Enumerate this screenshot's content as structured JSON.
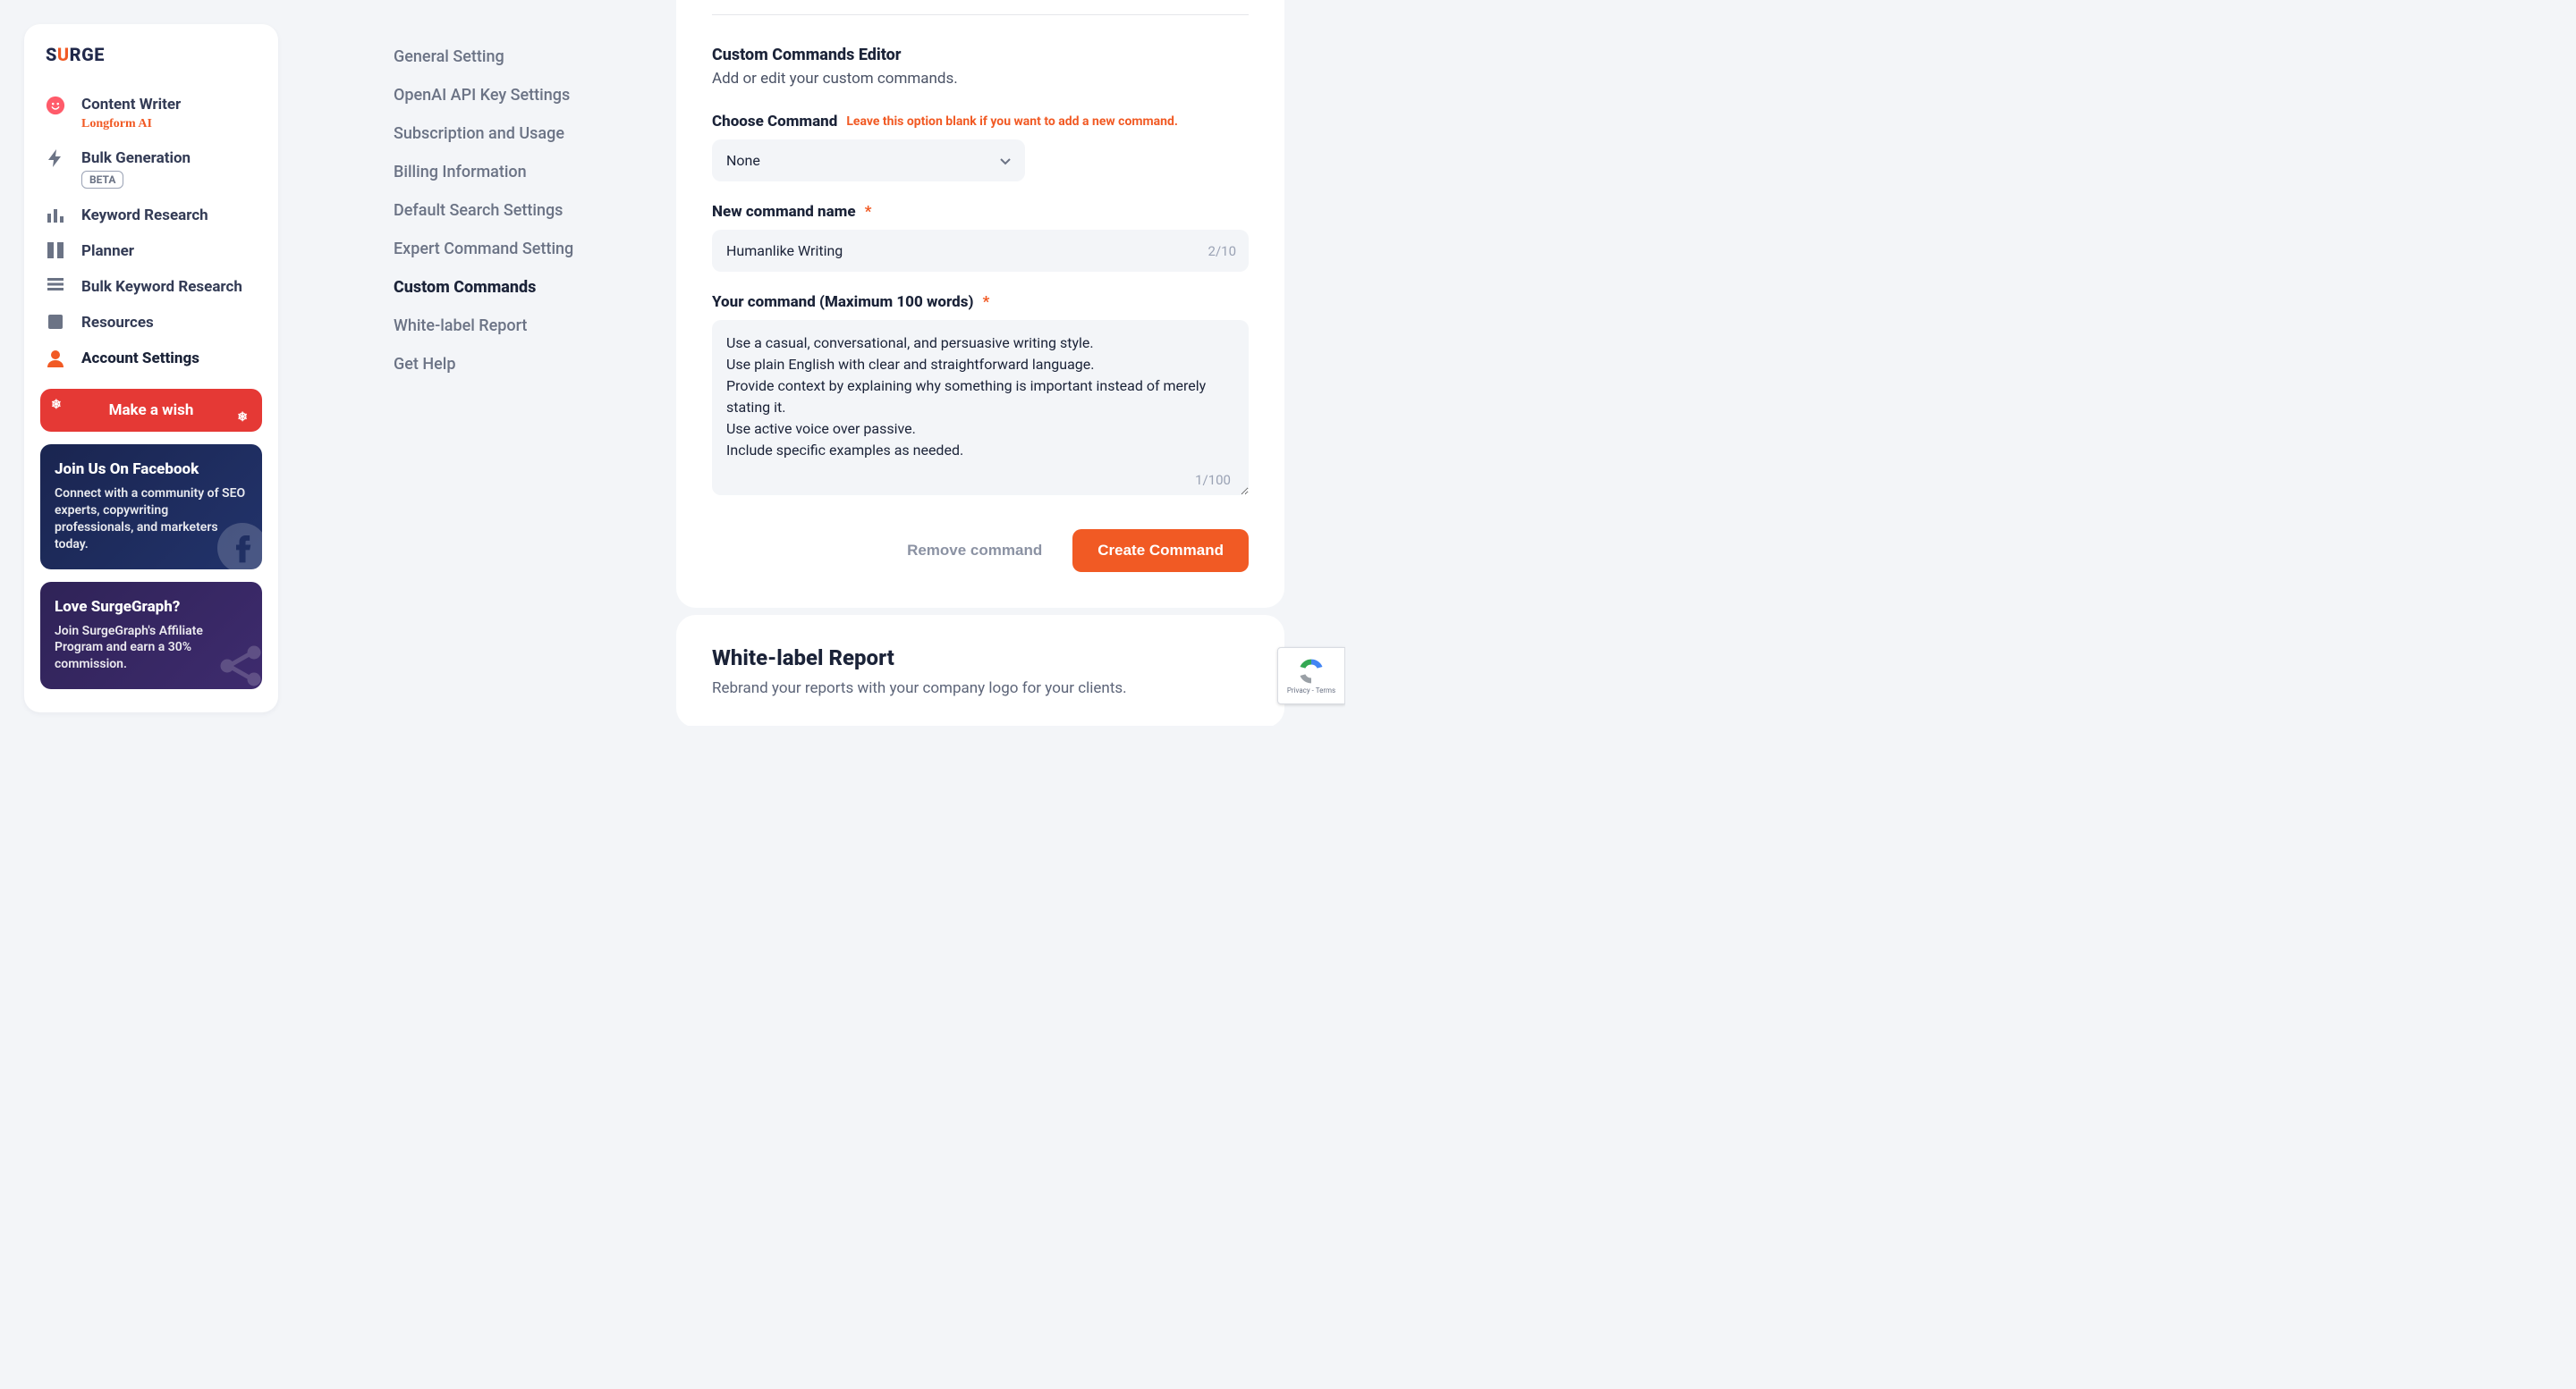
{
  "brand": {
    "name_left": "S",
    "name_mid": "U",
    "name_right": "RGE"
  },
  "sidebar": {
    "items": [
      {
        "label": "Content Writer",
        "sub": "Longform AI"
      },
      {
        "label": "Bulk Generation",
        "badge": "BETA"
      },
      {
        "label": "Keyword Research"
      },
      {
        "label": "Planner"
      },
      {
        "label": "Bulk Keyword Research"
      },
      {
        "label": "Resources"
      },
      {
        "label": "Account Settings"
      }
    ],
    "wish": {
      "text": "Make a wish"
    },
    "fb": {
      "title": "Join Us On Facebook",
      "body": "Connect with a community of SEO experts, copywriting professionals, and marketers today."
    },
    "love": {
      "title": "Love SurgeGraph?",
      "body": "Join SurgeGraph's Affiliate Program and earn a 30% commission."
    }
  },
  "settings_nav": [
    "General Setting",
    "OpenAI API Key Settings",
    "Subscription and Usage",
    "Billing Information",
    "Default Search Settings",
    "Expert Command Setting",
    "Custom Commands",
    "White-label Report",
    "Get Help"
  ],
  "settings_nav_active": "Custom Commands",
  "editor": {
    "title": "Custom Commands Editor",
    "subtitle": "Add or edit your custom commands.",
    "choose_label": "Choose Command",
    "choose_hint": "Leave this option blank if you want to add a new command.",
    "choose_value": "None",
    "name_label": "New command name",
    "name_value": "Humanlike Writing",
    "name_counter": "2/10",
    "cmd_label": "Your command (Maximum 100 words)",
    "cmd_value": "Use a casual, conversational, and persuasive writing style.\nUse plain English with clear and straightforward language.\nProvide context by explaining why something is important instead of merely stating it.\nUse active voice over passive.\nInclude specific examples as needed.",
    "cmd_counter": "1/100",
    "remove": "Remove command",
    "create": "Create Command"
  },
  "whitelabel": {
    "title": "White-label Report",
    "subtitle": "Rebrand your reports with your company logo for your clients."
  },
  "recaptcha": {
    "privacy": "Privacy",
    "terms": "Terms"
  }
}
